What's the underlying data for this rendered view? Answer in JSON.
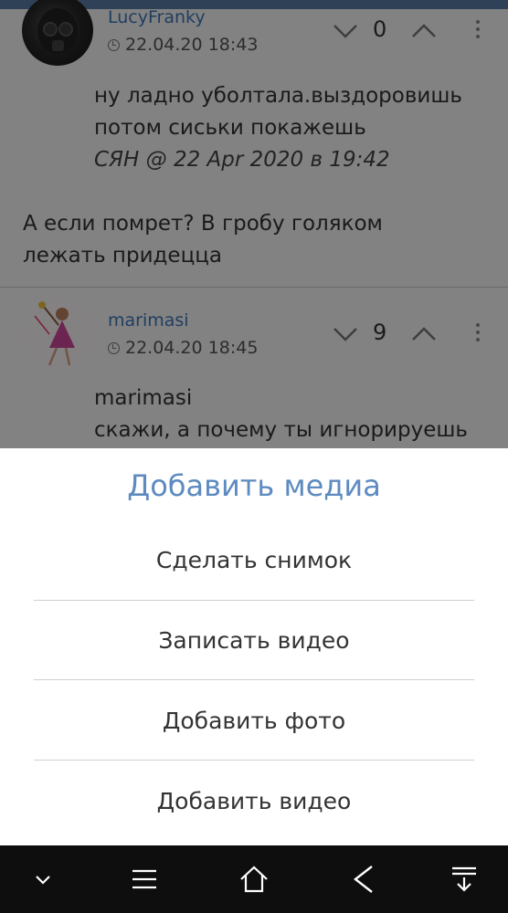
{
  "comments": [
    {
      "author": "LucyFranky",
      "time": "22.04.20 18:43",
      "score": "0",
      "quote_lines": [
        "ну ладно уболтала.выздоровишь",
        "потом сиськи покажешь"
      ],
      "quote_signature": "СЯН @ 22 Apr 2020 в 19:42",
      "text_lines": [
        "А если помрет? В гробу голяком",
        "лежать придецца"
      ]
    },
    {
      "author": "marimasi",
      "time": "22.04.20 18:45",
      "score": "9",
      "text_lines": [
        "marimasi",
        "скажи, а почему ты игнорируешь"
      ]
    }
  ],
  "media_sheet": {
    "title": "Добавить медиа",
    "options": [
      "Сделать снимок",
      "Записать видео",
      "Добавить фото",
      "Добавить видео"
    ]
  },
  "colors": {
    "link": "#3f78b8",
    "sheet_title": "#5d8bc0",
    "overlay": "rgba(0,0,0,0.48)",
    "navbar": "#0e0e0e"
  },
  "icons": [
    "clock-icon",
    "vote-down-icon",
    "vote-up-icon",
    "more-vert-icon",
    "chevron-down-icon",
    "menu-icon",
    "home-icon",
    "back-icon",
    "download-icon"
  ]
}
